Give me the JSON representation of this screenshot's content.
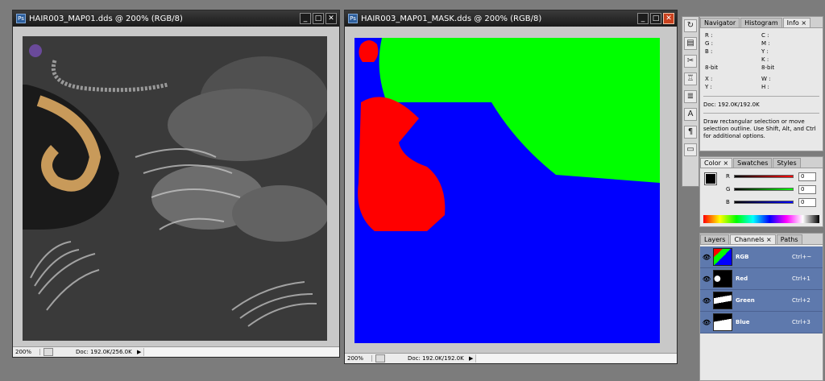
{
  "window1": {
    "title": "HAIR003_MAP01.dds @ 200% (RGB/8)",
    "minimize": "_",
    "maximize": "□",
    "close": "✕",
    "zoom": "200%",
    "doc": "Doc: 192.0K/256.0K",
    "arrow": "▶"
  },
  "window2": {
    "title": "HAIR003_MAP01_MASK.dds @ 200% (RGB/8)",
    "minimize": "_",
    "maximize": "□",
    "close": "✕",
    "zoom": "200%",
    "doc": "Doc: 192.0K/192.0K",
    "arrow": "▶"
  },
  "mask_colors": {
    "red": "#ff0000",
    "green": "#00ff00",
    "blue": "#0000ff"
  },
  "info_panel": {
    "tabs": [
      "Navigator",
      "Histogram",
      "Info"
    ],
    "tab_close": "×",
    "left_rgb": [
      "R :",
      "G :",
      "B :"
    ],
    "right_cmyk": [
      "C :",
      "M :",
      "Y :",
      "K :"
    ],
    "bit_left": "8-bit",
    "bit_right": "8-bit",
    "xy": [
      "X :",
      "Y :"
    ],
    "wh": [
      "W :",
      "H :"
    ],
    "doc": "Doc: 192.0K/192.0K",
    "hint": "Draw rectangular selection or move selection outline.  Use Shift, Alt, and Ctrl for additional options."
  },
  "color_panel": {
    "tabs": [
      "Color",
      "Swatches",
      "Styles"
    ],
    "tab_close": "×",
    "sliders": [
      {
        "label": "R",
        "value": "0"
      },
      {
        "label": "G",
        "value": "0"
      },
      {
        "label": "B",
        "value": "0"
      }
    ]
  },
  "layers_panel": {
    "tabs": [
      "Layers",
      "Channels",
      "Paths"
    ],
    "tab_close": "×",
    "channels": [
      {
        "name": "RGB",
        "shortcut": "Ctrl+~"
      },
      {
        "name": "Red",
        "shortcut": "Ctrl+1"
      },
      {
        "name": "Green",
        "shortcut": "Ctrl+2"
      },
      {
        "name": "Blue",
        "shortcut": "Ctrl+3"
      }
    ]
  },
  "tools": [
    "hand-icon",
    "screen-icon",
    "brush-icon",
    "stamp-icon",
    "layers-icon",
    "type-icon",
    "paragraph-icon",
    "notes-icon"
  ],
  "tool_glyphs": [
    "↻",
    "▤",
    "✂",
    "♖",
    "≣",
    "A",
    "¶",
    "▭"
  ],
  "eye_glyph": "👁"
}
